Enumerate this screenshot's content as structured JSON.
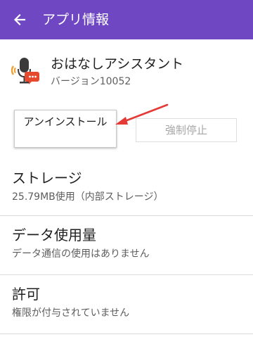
{
  "appbar": {
    "title": "アプリ情報",
    "back_icon": "arrow-left-icon",
    "color": "#6f47c3"
  },
  "app": {
    "name": "おはなしアシスタント",
    "version": "バージョン10052",
    "icon": "microphone-chat-icon"
  },
  "actions": {
    "uninstall_label": "アンインストール",
    "force_stop_label": "強制停止"
  },
  "annotation": {
    "icon": "red-arrow-icon",
    "color": "#e53935"
  },
  "sections": [
    {
      "title": "ストレージ",
      "subtitle": "25.79MB使用（内部ストレージ）"
    },
    {
      "title": "データ使用量",
      "subtitle": "データ通信の使用はありません"
    },
    {
      "title": "許可",
      "subtitle": "権限が付与されていません"
    }
  ]
}
